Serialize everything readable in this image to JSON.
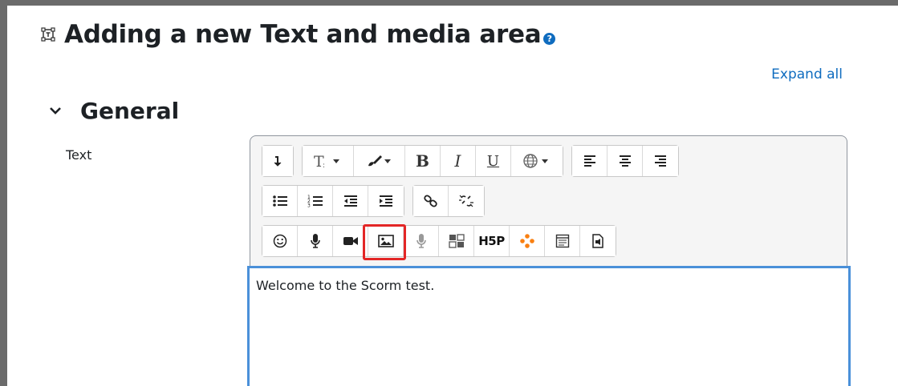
{
  "page": {
    "title": "Adding a new Text and media area",
    "title_icon": "text-media-icon",
    "help_icon": "help-icon",
    "expand_all_label": "Expand all"
  },
  "section": {
    "title": "General",
    "expanded": true
  },
  "field": {
    "label": "Text"
  },
  "editor": {
    "toolbar_rows": [
      [
        [
          "collapse-toolbar"
        ],
        [
          "font-size",
          "text-color",
          "bold",
          "italic",
          "underline",
          "language"
        ],
        [
          "align-left",
          "align-center",
          "align-right"
        ]
      ],
      [
        [
          "unordered-list",
          "ordered-list",
          "outdent",
          "indent"
        ],
        [
          "link",
          "unlink"
        ]
      ],
      [
        [
          "emoji",
          "record-audio",
          "record-video",
          "insert-image",
          "media",
          "manage-files",
          "h5p",
          "moodle-media",
          "accessibility-checker",
          "screen-reader-helper"
        ]
      ]
    ],
    "h5p_label": "H5P",
    "bold_label": "B",
    "italic_label": "I",
    "underline_label": "U",
    "highlighted_button": "insert-image",
    "content": "Welcome to the Scorm test."
  },
  "colors": {
    "link": "#0f6cbf",
    "highlight": "#e32626",
    "focus_border": "#4a90d9",
    "moodle_media_orange": "#f98012"
  }
}
